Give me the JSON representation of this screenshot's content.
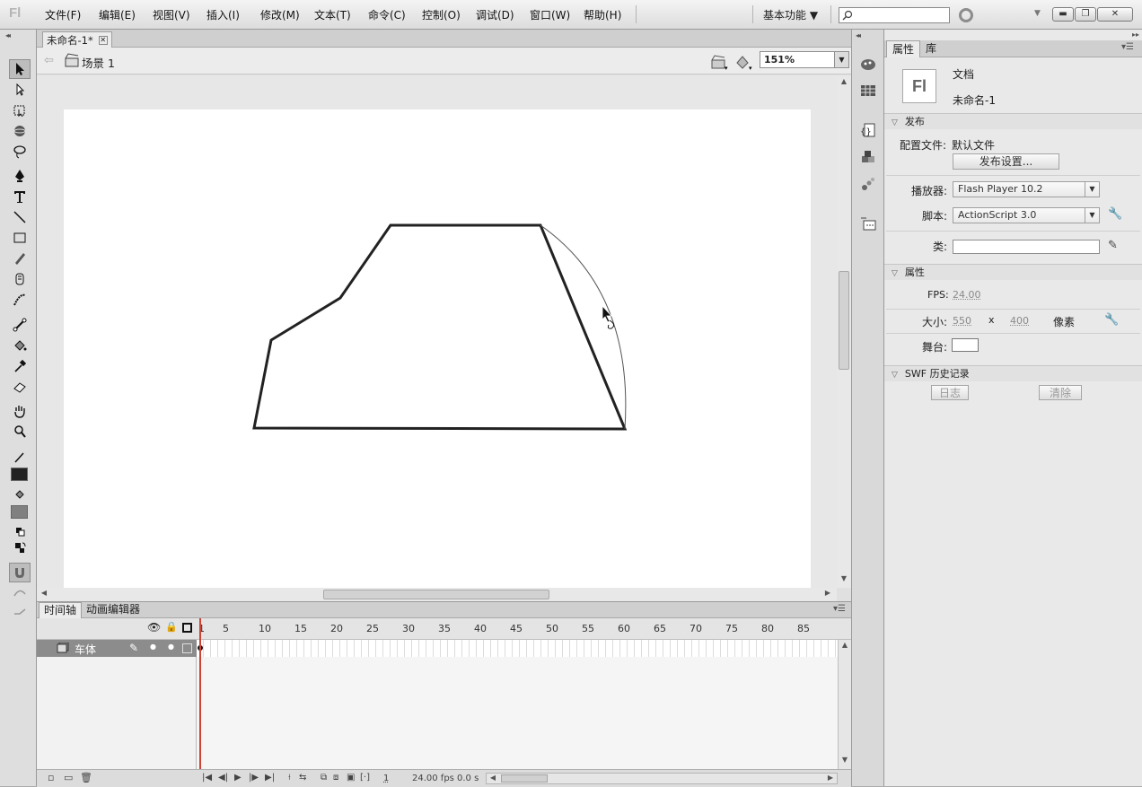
{
  "app": {
    "logo": "Fl"
  },
  "menu": [
    "文件(F)",
    "编辑(E)",
    "视图(V)",
    "插入(I)",
    "修改(M)",
    "文本(T)",
    "命令(C)",
    "控制(O)",
    "调试(D)",
    "窗口(W)",
    "帮助(H)"
  ],
  "workspace": {
    "label": "基本功能 ▼"
  },
  "search": {
    "placeholder": ""
  },
  "document": {
    "tab_title": "未命名-1*",
    "scene": "场景 1",
    "zoom": "151%"
  },
  "timeline": {
    "tabs": [
      "时间轴",
      "动画编辑器"
    ],
    "frame_numbers": [
      "1",
      "5",
      "10",
      "15",
      "20",
      "25",
      "30",
      "35",
      "40",
      "45",
      "50",
      "55",
      "60",
      "65",
      "70",
      "75",
      "80",
      "85"
    ],
    "layer_name": "车体",
    "current_frame": "1",
    "fps": "24.00 fps",
    "elapsed": "0.0 s"
  },
  "properties": {
    "tabs": [
      "属性",
      "库"
    ],
    "type": "文档",
    "doc_name": "未命名-1",
    "publish_section": "发布",
    "profile_label": "配置文件:",
    "profile_value": "默认文件",
    "publish_settings_button": "发布设置...",
    "player_label": "播放器:",
    "player_value": "Flash Player 10.2",
    "script_label": "脚本:",
    "script_value": "ActionScript 3.0",
    "class_label": "类:",
    "class_value": "",
    "props_section": "属性",
    "fps_label": "FPS:",
    "fps_value": "24.00",
    "size_label": "大小:",
    "width": "550",
    "x": "x",
    "height": "400",
    "unit": "像素",
    "stage_label": "舞台:",
    "stage_color": "#ffffff",
    "swf_section": "SWF 历史记录",
    "log_button": "日志",
    "clear_button": "清除"
  },
  "colors": {
    "stroke": "#222222",
    "fill": "#808080"
  }
}
